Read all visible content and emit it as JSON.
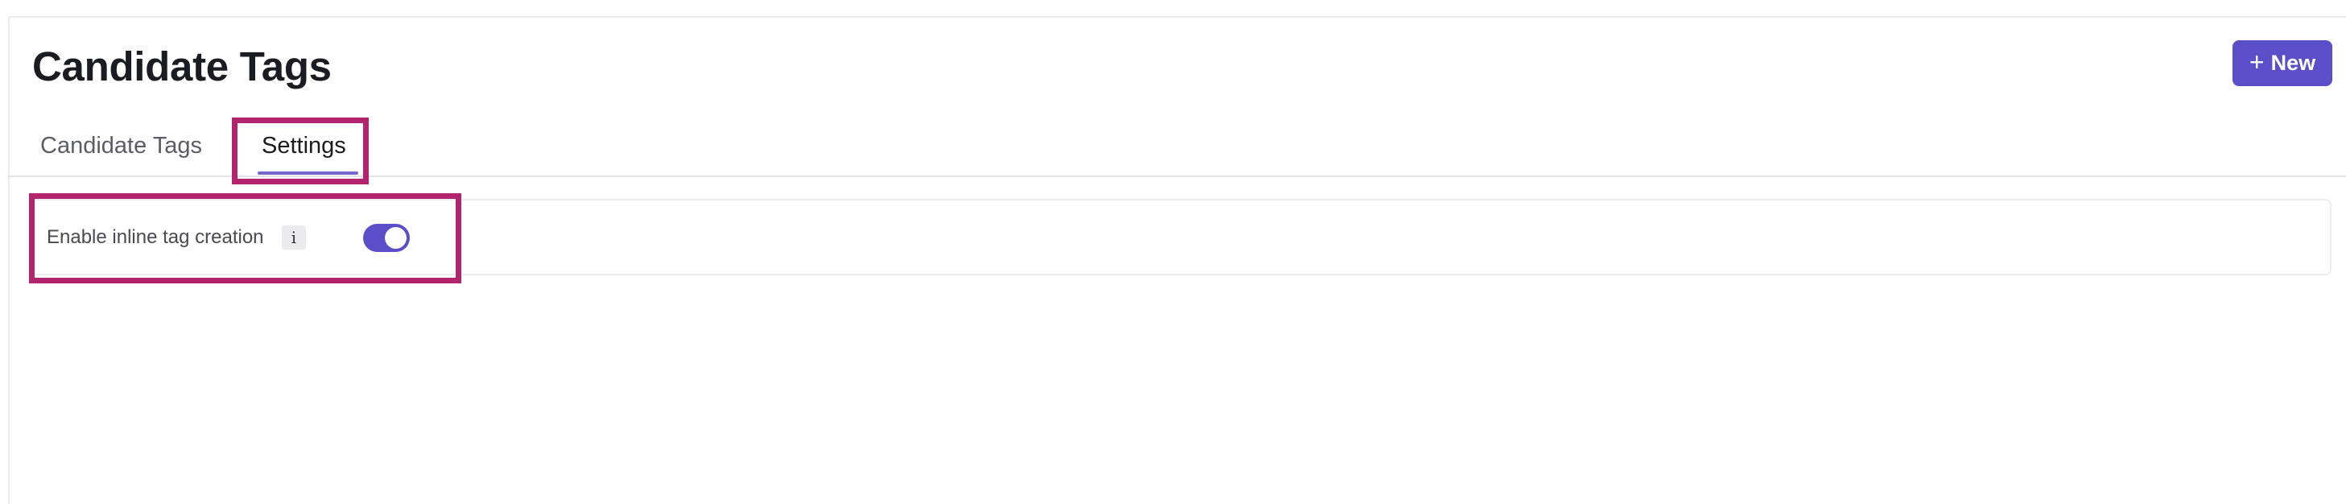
{
  "header": {
    "title": "Candidate Tags",
    "new_button_icon": "plus-icon",
    "new_button_label": "New"
  },
  "tabs": [
    {
      "label": "Candidate Tags",
      "active": false
    },
    {
      "label": "Settings",
      "active": true
    }
  ],
  "settings": {
    "inline_tag_creation": {
      "label": "Enable inline tag creation",
      "info_icon_glyph": "i",
      "enabled": true
    }
  },
  "colors": {
    "accent": "#5b4fc9",
    "highlight": "#b3246f",
    "tab_underline": "#7468cf"
  }
}
